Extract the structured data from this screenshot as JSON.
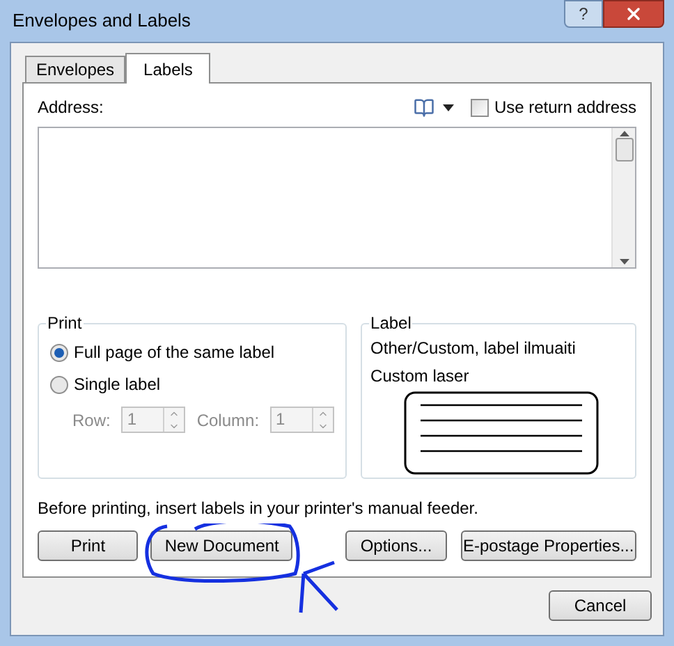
{
  "window": {
    "title": "Envelopes and Labels",
    "help": "?"
  },
  "tabs": [
    {
      "label": "Envelopes",
      "selected": false
    },
    {
      "label": "Labels",
      "selected": true
    }
  ],
  "address": {
    "label": "Address:",
    "use_return_address": {
      "label": "Use return address",
      "checked": false
    }
  },
  "print_group": {
    "title": "Print",
    "options": [
      {
        "label": "Full page of the same label",
        "selected": true
      },
      {
        "label": "Single label",
        "selected": false
      }
    ],
    "spinners": [
      {
        "label": "Row:",
        "value": "1",
        "disabled": true
      },
      {
        "label": "Column:",
        "value": "1",
        "disabled": true
      }
    ]
  },
  "label_group": {
    "title": "Label",
    "lines": [
      "Other/Custom, label ilmuaiti",
      "Custom laser"
    ]
  },
  "note": "Before printing, insert labels in your printer's manual feeder.",
  "buttons": [
    "Print",
    "New Document",
    "Options...",
    "E-postage Properties..."
  ],
  "cancel": "Cancel"
}
